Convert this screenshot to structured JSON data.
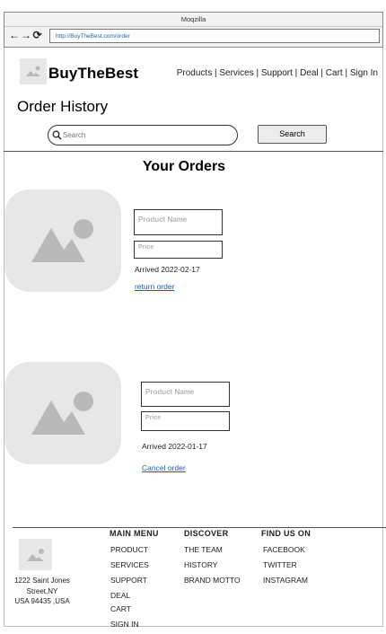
{
  "browser": {
    "title": "Moqzilla",
    "url": "http://BuyTheBest.com/order",
    "back_icon": "arrow-left-icon",
    "forward_icon": "arrow-right-icon",
    "reload_icon": "reload-icon"
  },
  "header": {
    "brand": "BuyTheBest",
    "nav": [
      "Products",
      "Services",
      "Support",
      "Deal",
      "Cart",
      "Sign In"
    ],
    "nav_separator": " | "
  },
  "page": {
    "title": "Order History",
    "search_placeholder": "Search",
    "search_button": "Search",
    "section_title": "Your Orders"
  },
  "orders": [
    {
      "product_name_placeholder": "Product Name",
      "price_placeholder": "Price",
      "arrived": "Arrived 2022-02-17",
      "action": "return order"
    },
    {
      "product_name_placeholder": "Product Name",
      "price_placeholder": "Price",
      "arrived": "Arrived 2022-01-17",
      "action": "Cancel order"
    }
  ],
  "footer": {
    "address_line1": "1222 Saint Jones",
    "address_line2": "Street,NY",
    "address_line3": "USA 94435 ,USA",
    "main_menu": {
      "title": "MAIN MENU",
      "items": [
        "PRODUCT",
        "SERVICES",
        "SUPPORT",
        "DEAL",
        "CART",
        "SIGN IN"
      ]
    },
    "discover": {
      "title": "DISCOVER",
      "items": [
        "THE TEAM",
        "HISTORY",
        "BRAND MOTTO"
      ]
    },
    "find_us": {
      "title": "FIND US ON",
      "items": [
        "FACEBOOK",
        "TWITTER",
        "INSTAGRAM"
      ]
    }
  },
  "colors": {
    "placeholder_bg": "#e7e7e7",
    "placeholder_icon": "#b9b9b9",
    "link": "#1a5fb4"
  }
}
